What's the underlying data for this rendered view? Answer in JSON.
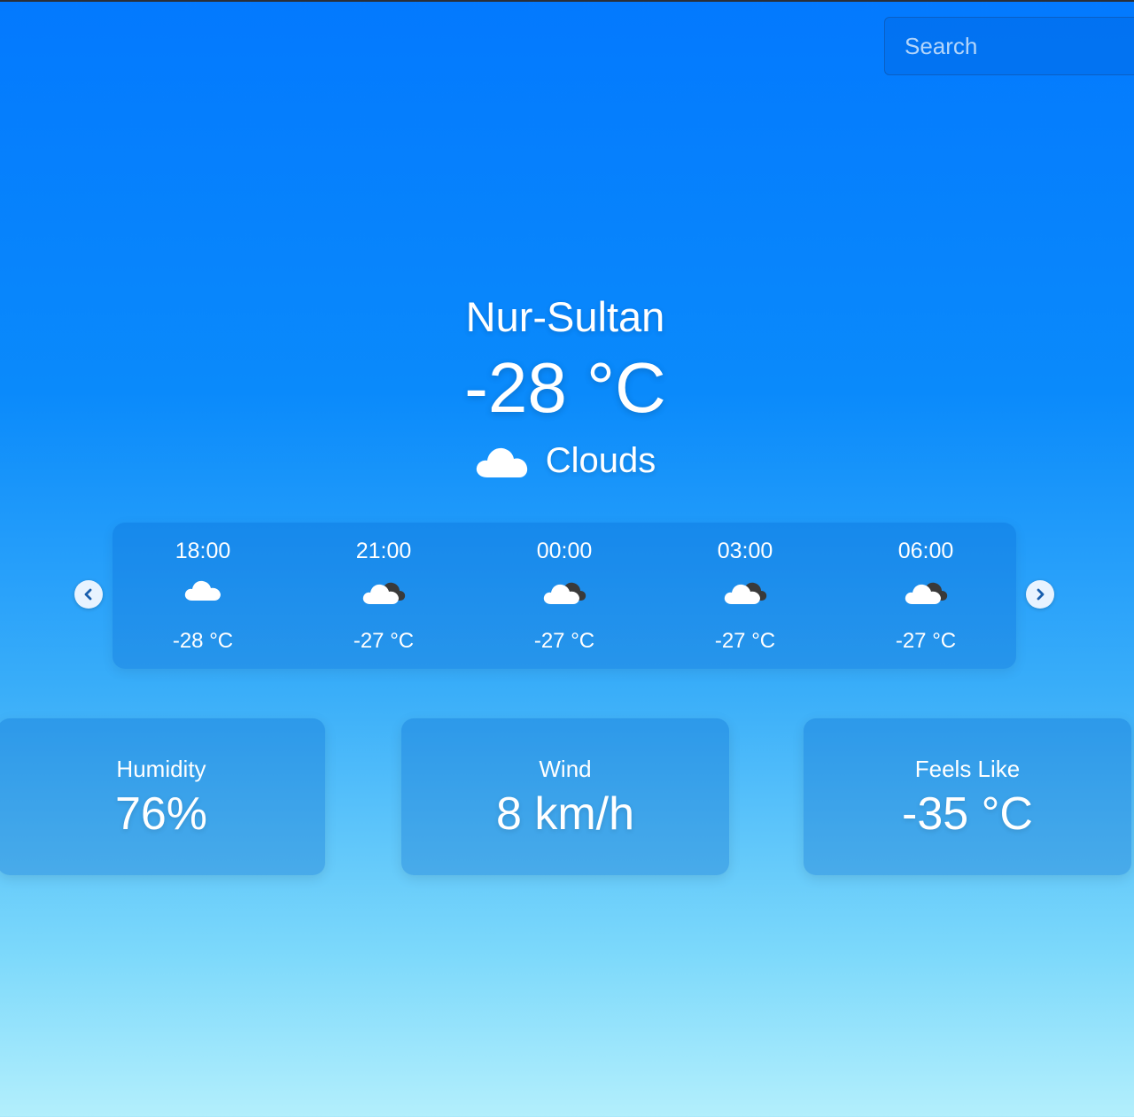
{
  "search": {
    "placeholder": "Search"
  },
  "current": {
    "city": "Nur-Sultan",
    "temperature": "-28 °C",
    "condition": "Clouds",
    "condition_icon": "cloud-icon"
  },
  "forecast": [
    {
      "time": "18:00",
      "temp": "-28 °C",
      "icon": "cloud-icon"
    },
    {
      "time": "21:00",
      "temp": "-27 °C",
      "icon": "broken-clouds-icon"
    },
    {
      "time": "00:00",
      "temp": "-27 °C",
      "icon": "broken-clouds-icon"
    },
    {
      "time": "03:00",
      "temp": "-27 °C",
      "icon": "broken-clouds-icon"
    },
    {
      "time": "06:00",
      "temp": "-27 °C",
      "icon": "broken-clouds-icon"
    }
  ],
  "details": {
    "humidity": {
      "label": "Humidity",
      "value": "76%"
    },
    "wind": {
      "label": "Wind",
      "value": "8 km/h"
    },
    "feels_like": {
      "label": "Feels Like",
      "value": "-35 °C"
    }
  },
  "colors": {
    "background_top": "#0379fe",
    "background_bottom": "#b3effc",
    "text": "#ffffff"
  }
}
